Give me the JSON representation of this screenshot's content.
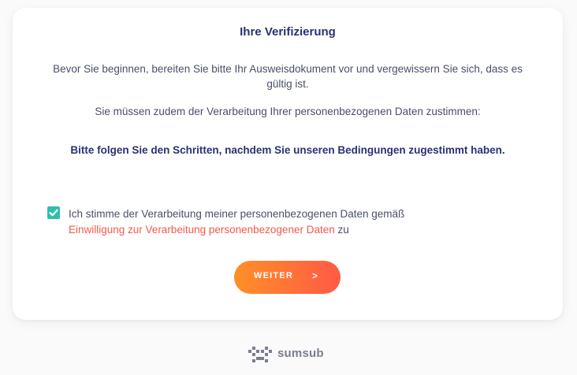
{
  "card": {
    "title": "Ihre Verifizierung",
    "intro": "Bevor Sie beginnen, bereiten Sie bitte Ihr Ausweisdokument vor und vergewissern Sie sich, dass es gültig ist.",
    "consent_note": "Sie müssen zudem der Verarbeitung Ihrer personenbezogenen Daten zustimmen:",
    "emphasis": "Bitte folgen Sie den Schritten, nachdem Sie unseren Bedingungen zugestimmt haben."
  },
  "consent": {
    "checked": true,
    "label_before": "Ich stimme der Verarbeitung meiner personenbezogenen Daten gemäß",
    "link_text": "Einwilligung zur Verarbeitung personenbezogener Daten",
    "label_after": "zu"
  },
  "button": {
    "label": "WEITER",
    "arrow": ">"
  },
  "footer": {
    "brand": "sumsub"
  },
  "colors": {
    "heading": "#2b3174",
    "text": "#4a4f6a",
    "checkbox": "#2ebfae",
    "link": "#f15a4e",
    "button_gradient_start": "#ff8f28",
    "button_gradient_end": "#ff5a45",
    "brand_gray": "#7b7e8e"
  },
  "icons": {
    "checkbox": "checkmark-icon",
    "button_arrow": "chevron-right-icon",
    "logo": "sumsub-logo-icon"
  }
}
